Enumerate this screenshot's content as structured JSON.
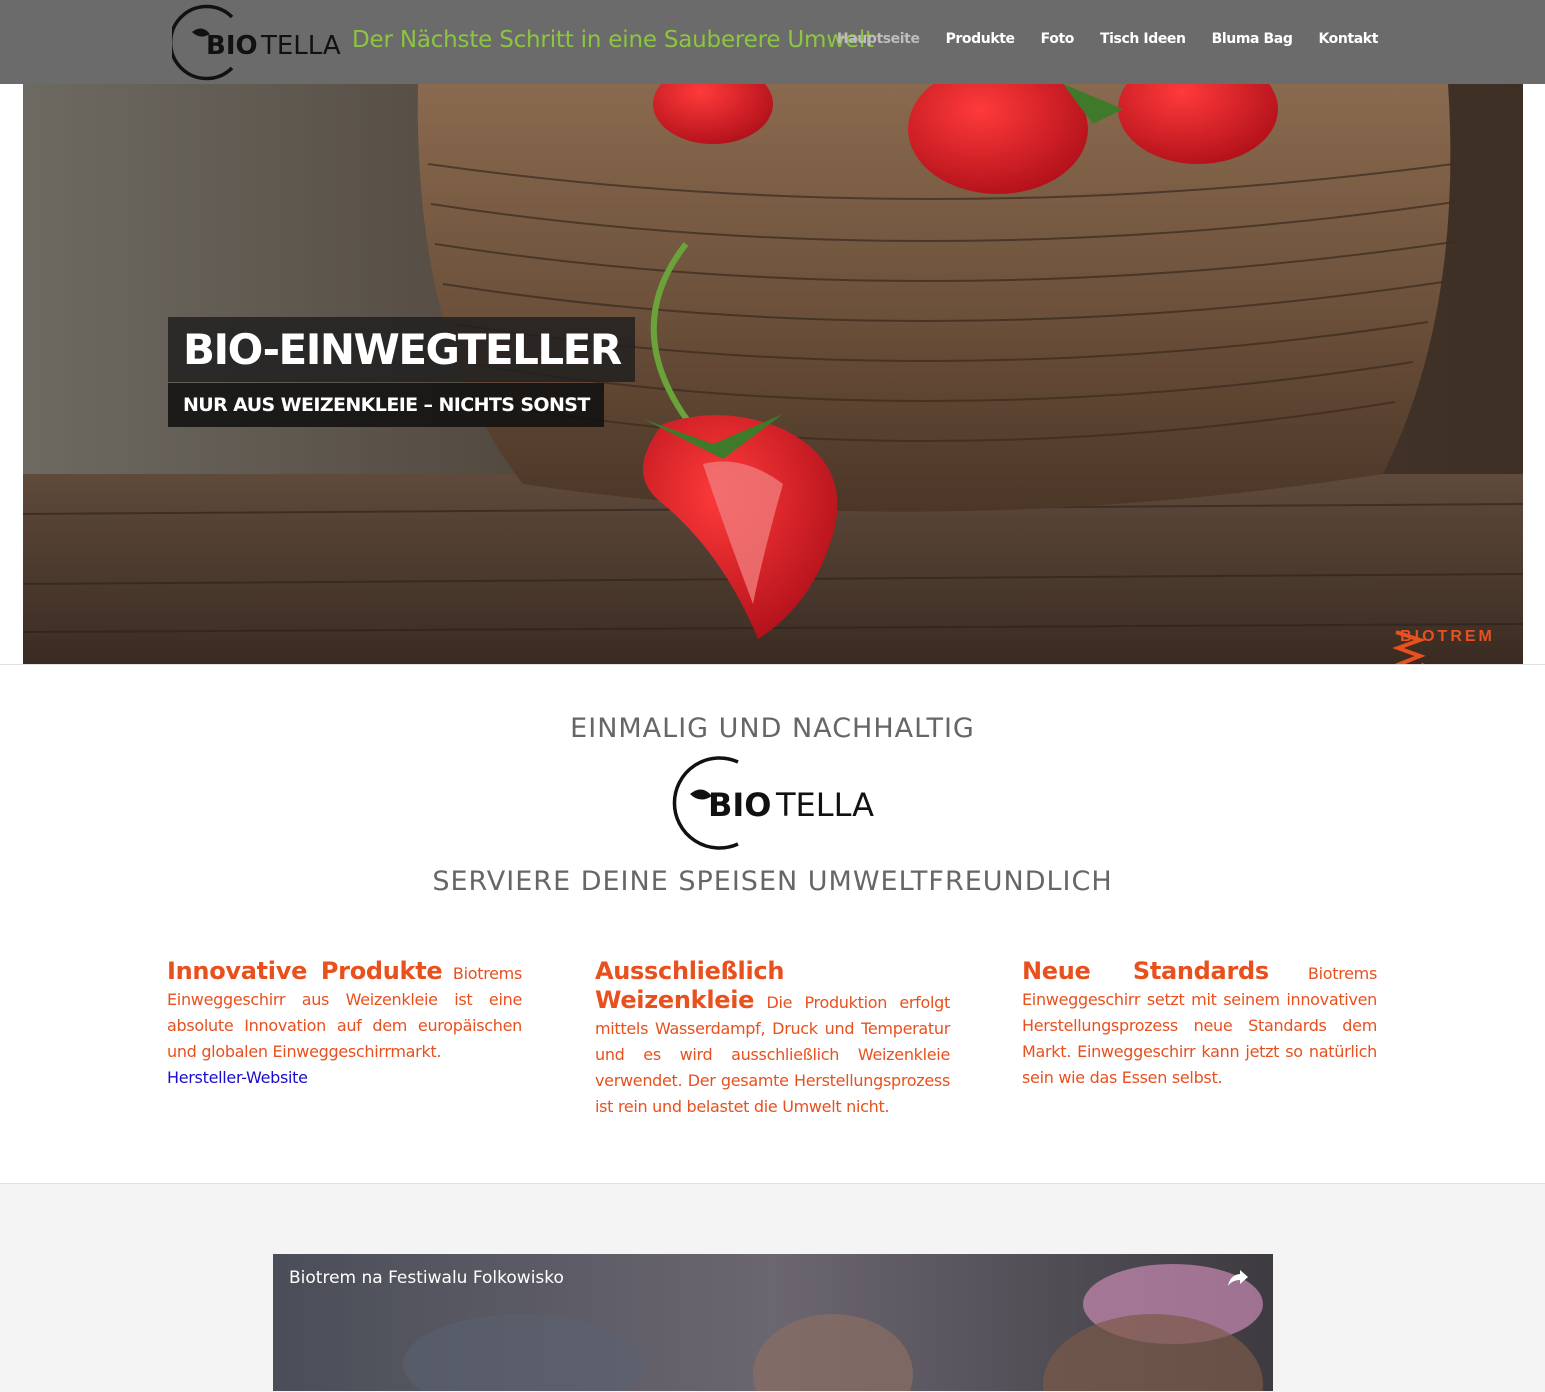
{
  "header": {
    "logo_text": "BIOTELLA",
    "tagline": "Der Nächste Schritt in eine Sauberere Umwelt",
    "nav": [
      {
        "label": "Hauptseite",
        "active": true
      },
      {
        "label": "Produkte",
        "active": false
      },
      {
        "label": "Foto",
        "active": false
      },
      {
        "label": "Tisch Ideen",
        "active": false
      },
      {
        "label": "Bluma Bag",
        "active": false
      },
      {
        "label": "Kontakt",
        "active": false
      }
    ]
  },
  "hero": {
    "title": "BIO-EINWEGTELLER",
    "subtitle": "NUR AUS WEIZENKLEIE – NICHTS SONST",
    "brand_logo": "BIOTREM"
  },
  "intro": {
    "heading": "EINMALIG UND NACHHALTIG",
    "logo_text": "BIOTELLA",
    "subheading": "SERVIERE DEINE SPEISEN UMWELTFREUNDLICH"
  },
  "features": [
    {
      "title": "Innovative Produkte",
      "text": "Biotrems Einweggeschirr aus Weizenkleie ist eine absolute Innovation auf dem europäischen und globalen Einweggeschirrmarkt.",
      "link": "Hersteller-Website"
    },
    {
      "title": "Ausschließlich Weizenkleie",
      "text": "Die Produktion erfolgt mittels Wasserdampf, Druck und Temperatur und es wird ausschließlich Weizenkleie verwendet. Der gesamte Herstellungsprozess ist rein und belastet die Umwelt nicht."
    },
    {
      "title": "Neue Standards",
      "text": "Biotrems Einweggeschirr setzt mit seinem innovativen Herstellungsprozess neue Standards dem Markt. Einweggeschirr kann jetzt so natürlich sein wie das Essen selbst."
    }
  ],
  "video": {
    "title": "Biotrem na Festiwalu Folkowisko",
    "share_icon": "share-icon"
  },
  "colors": {
    "header_bg": "#6b6b6b",
    "tagline": "#8cc63f",
    "accent": "#e8501d",
    "link": "#1a0dcc"
  }
}
